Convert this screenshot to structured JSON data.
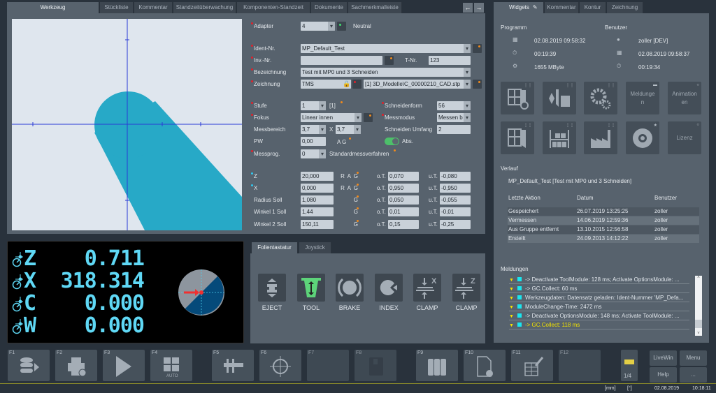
{
  "main_tabs": [
    "Werkzeug messen/einstellen/verwalten",
    "Stückliste",
    "Kommentar",
    "Standzeitüberwachung",
    "Komponenten-Standzeit",
    "Dokumente",
    "Sachmerkmalleiste"
  ],
  "form": {
    "adapter": {
      "label": "Adapter",
      "value": "4",
      "status": "Neutral"
    },
    "ident": {
      "label": "Ident-Nr.",
      "value": "MP_Default_Test"
    },
    "inv": {
      "label": "Inv.-Nr.",
      "value": "",
      "tnr_label": "T-Nr.",
      "tnr_value": "123"
    },
    "bezeichnung": {
      "label": "Bezeichnung",
      "value": "Test mit MP0 und 3 Schneiden"
    },
    "zeichnung": {
      "label": "Zeichnung",
      "value": "TMS",
      "file": "[1] 3D_Modelle\\C_00000210_CAD.stp"
    },
    "stufe": {
      "label": "Stufe",
      "value": "1",
      "extra": "[1]"
    },
    "schneidenform": {
      "label": "Schneidenform",
      "value": "56"
    },
    "fokus": {
      "label": "Fokus",
      "value": "Linear innen"
    },
    "messmodus": {
      "label": "Messmodus",
      "value": "Messen b"
    },
    "messbereich": {
      "label": "Messbereich",
      "value1": "3,7",
      "x": "X",
      "value2": "3,7"
    },
    "schneiden_umfang": {
      "label": "Schneiden Umfang",
      "value": "2"
    },
    "pw": {
      "label": "PW",
      "value": "0,00",
      "ag": "A G"
    },
    "abs": {
      "label": "Abs.",
      "on": true
    },
    "messprog": {
      "label": "Messprog.",
      "value": "0",
      "desc": "Standardmessverfahren"
    },
    "rows": [
      {
        "label": "Z",
        "value": "20,000",
        "flags": "R A G",
        "ot": "0,070",
        "ut": "-0,080"
      },
      {
        "label": "X",
        "value": "0,000",
        "flags": "R A G",
        "ot": "0,950",
        "ut": "-0,950"
      },
      {
        "label": "Radius Soll",
        "value": "1,080",
        "flags": "G",
        "ot": "0,050",
        "ut": "-0,055"
      },
      {
        "label": "Winkel 1 Soll",
        "value": "1,44",
        "flags": "G",
        "ot": "0,01",
        "ut": "-0,01"
      },
      {
        "label": "Winkel 2 Soll",
        "value": "150,11",
        "flags": "G",
        "ot": "0,15",
        "ut": "-0,25"
      }
    ],
    "ot_label": "o.T.",
    "ut_label": "u.T."
  },
  "dro": [
    {
      "axis": "Z",
      "value": "0.711"
    },
    {
      "axis": "X",
      "value": "318.314"
    },
    {
      "axis": "C",
      "value": "0.000"
    },
    {
      "axis": "W",
      "value": "0.000"
    }
  ],
  "foil": {
    "tabs": [
      "Folientastatur",
      "Joystick"
    ],
    "buttons": [
      "EJECT",
      "TOOL",
      "BRAKE",
      "INDEX",
      "CLAMP",
      "CLAMP"
    ],
    "clamp_axes": [
      "X",
      "Z"
    ]
  },
  "right_tabs": [
    "Widgets",
    "Kommentar",
    "Kontur",
    "Zeichnung"
  ],
  "widgets": {
    "programm_label": "Programm",
    "benutzer_label": "Benutzer",
    "programm": [
      "02.08.2019 09:58:32",
      "00:19:39",
      "1655 MByte"
    ],
    "benutzer": [
      "zoller [DEV]",
      "02.08.2019 09:58:37",
      "00:19:34"
    ],
    "tiles": [
      "",
      "",
      "",
      "Meldunge n",
      "Animation en",
      "",
      "",
      "",
      "",
      "Lizenz"
    ]
  },
  "verlauf": {
    "label": "Verlauf",
    "title": "MP_Default_Test [Test mit MP0 und 3 Schneiden]",
    "headers": [
      "Letzte Aktion",
      "Datum",
      "Benutzer"
    ],
    "rows": [
      [
        "Gespeichert",
        "26.07.2019 13:25:25",
        "zoller"
      ],
      [
        "Vermessen",
        "14.06.2019 12:59:36",
        "zoller"
      ],
      [
        "Aus Gruppe entfernt",
        "13.10.2015 12:56:58",
        "zoller"
      ],
      [
        "Erstellt",
        "24.09.2013 14:12:22",
        "zoller"
      ]
    ]
  },
  "meldungen": {
    "label": "Meldungen",
    "items": [
      "-> Deactivate ToolModule: 128 ms; Activate OptionsModule: ...",
      "-> GC.Collect: 60 ms",
      "Werkzeugdaten: Datensatz geladen: Ident-Nummer 'MP_Defa...",
      "ModuleChange-Time: 2472 ms",
      "-> Deactivate OptionsModule: 148 ms; Activate ToolModule: ...",
      "-> GC.Collect: 118 ms"
    ]
  },
  "fkeys": [
    "F1",
    "F2",
    "F3",
    "F4",
    "F5",
    "F6",
    "F7",
    "F8",
    "F9",
    "F10",
    "F11",
    "F12"
  ],
  "f4_sub": "AUTO",
  "page": "1/4",
  "side_buttons": [
    "LiveWin",
    "Menu",
    "Help",
    "..."
  ],
  "status": {
    "unit1": "[mm]",
    "unit2": "[°]",
    "date": "02.08.2019",
    "time": "10:18:11"
  },
  "colors": {
    "accent_teal": "#27a9c7",
    "dro": "#5fd8f5",
    "tool_green": "#5dd47a",
    "warn": "#f2e200"
  }
}
